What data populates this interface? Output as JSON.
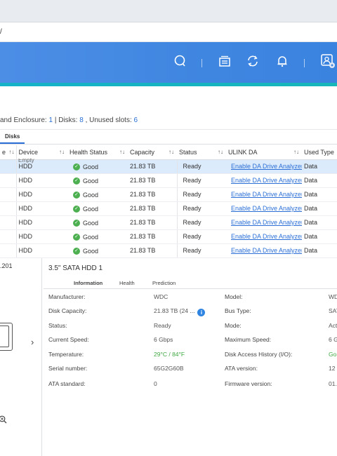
{
  "browser": {
    "address_text": "/"
  },
  "app_bar": {
    "icons": [
      "search-icon",
      "tasks-icon",
      "sync-icon",
      "bell-icon",
      "user-icon"
    ]
  },
  "summary": {
    "enclosure_label": "and Enclosure:",
    "enclosure_count": "1",
    "disks_label": "| Disks:",
    "disks_count": "8",
    "unused_label": ", Unused slots:",
    "unused_count": "6"
  },
  "tabs": [
    {
      "label": "Disks"
    }
  ],
  "table": {
    "columns": [
      "e ↑↓",
      "Device",
      "↑↓",
      "Health Status",
      "↑↓",
      "Capacity",
      "↑↓",
      "Status",
      "↑↓",
      "ULINK DA",
      "↑↓",
      "Used Type"
    ],
    "col_labels": {
      "c0": "e",
      "device": "Device",
      "health": "Health Status",
      "capacity": "Capacity",
      "status": "Status",
      "ulink": "ULINK DA",
      "used": "Used Type"
    },
    "sort_glyph": "↑↓",
    "partial_first_row": "Empty",
    "rows": [
      {
        "device": "HDD",
        "health": "Good",
        "capacity": "21.83 TB",
        "status": "Ready",
        "ulink": "Enable DA Drive Analyzer",
        "used": "Data"
      },
      {
        "device": "HDD",
        "health": "Good",
        "capacity": "21.83 TB",
        "status": "Ready",
        "ulink": "Enable DA Drive Analyzer",
        "used": "Data"
      },
      {
        "device": "HDD",
        "health": "Good",
        "capacity": "21.83 TB",
        "status": "Ready",
        "ulink": "Enable DA Drive Analyzer",
        "used": "Data"
      },
      {
        "device": "HDD",
        "health": "Good",
        "capacity": "21.83 TB",
        "status": "Ready",
        "ulink": "Enable DA Drive Analyzer",
        "used": "Data"
      },
      {
        "device": "HDD",
        "health": "Good",
        "capacity": "21.83 TB",
        "status": "Ready",
        "ulink": "Enable DA Drive Analyzer",
        "used": "Data"
      },
      {
        "device": "HDD",
        "health": "Good",
        "capacity": "21.83 TB",
        "status": "Ready",
        "ulink": "Enable DA Drive Analyzer",
        "used": "Data"
      },
      {
        "device": "HDD",
        "health": "Good",
        "capacity": "21.83 TB",
        "status": "Ready",
        "ulink": "Enable DA Drive Analyzer",
        "used": "Data"
      }
    ]
  },
  "left_pane": {
    "ip_fragment": ".201"
  },
  "detail": {
    "title": "3.5\" SATA HDD 1",
    "subtabs": [
      "Information",
      "Health",
      "Prediction"
    ],
    "fields_left": [
      {
        "label": "Manufacturer:",
        "value": "WDC"
      },
      {
        "label": "Disk Capacity:",
        "value": "21.83 TB (24 ..."
      },
      {
        "label": "Status:",
        "value": "Ready"
      },
      {
        "label": "Current Speed:",
        "value": "6 Gbps"
      },
      {
        "label": "Temperature:",
        "value": "29°C / 84°F"
      },
      {
        "label": "Serial number:",
        "value": "65G2G60B"
      },
      {
        "label": "ATA standard:",
        "value": "0"
      }
    ],
    "fields_right": [
      {
        "label": "Model:",
        "value": "WD"
      },
      {
        "label": "Bus Type:",
        "value": "SAT"
      },
      {
        "label": "Mode:",
        "value": "Act"
      },
      {
        "label": "Maximum Speed:",
        "value": "6 G"
      },
      {
        "label": "Disk Access History (I/O):",
        "value": "Go"
      },
      {
        "label": "ATA version:",
        "value": "12"
      },
      {
        "label": "Firmware version:",
        "value": "01."
      }
    ]
  },
  "colors": {
    "accent": "#2b6fd6",
    "appbar": "#3f86e0",
    "stripe": "#16b2c8",
    "good": "#4caf50",
    "selected_row": "#dcebfb"
  }
}
